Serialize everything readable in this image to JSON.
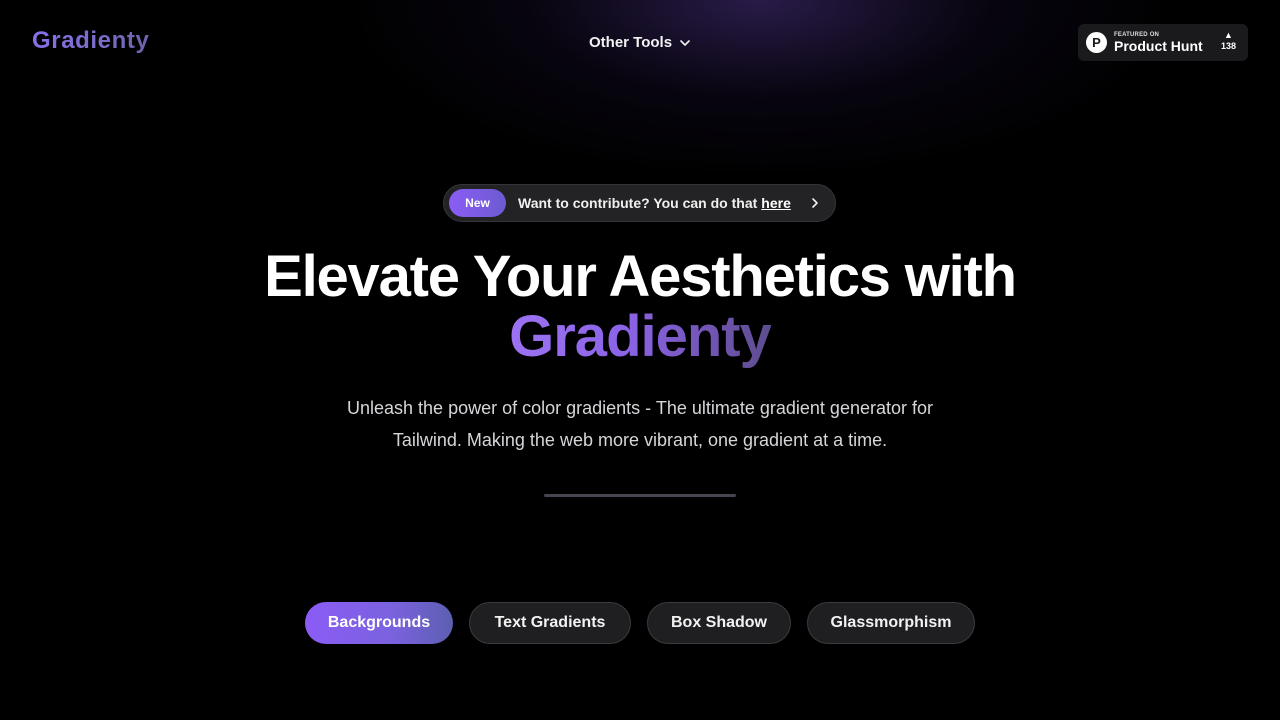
{
  "header": {
    "logo": "Gradienty",
    "other_tools_label": "Other Tools",
    "product_hunt": {
      "featured_label": "FEATURED ON",
      "name": "Product Hunt",
      "votes": "138"
    }
  },
  "announcement": {
    "badge": "New",
    "text": "Want to contribute? You can do that",
    "link_text": "here"
  },
  "hero": {
    "headline": "Elevate Your Aesthetics with",
    "headline_accent": "Gradienty",
    "subtitle_line1": "Unleash the power of color gradients - The ultimate gradient generator for",
    "subtitle_line2": "Tailwind. Making the web more vibrant, one gradient at a time."
  },
  "tabs": [
    {
      "label": "Backgrounds",
      "active": true
    },
    {
      "label": "Text Gradients",
      "active": false
    },
    {
      "label": "Box Shadow",
      "active": false
    },
    {
      "label": "Glassmorphism",
      "active": false
    }
  ],
  "colors": {
    "accent": "#8b5cf6",
    "background": "#000000"
  }
}
